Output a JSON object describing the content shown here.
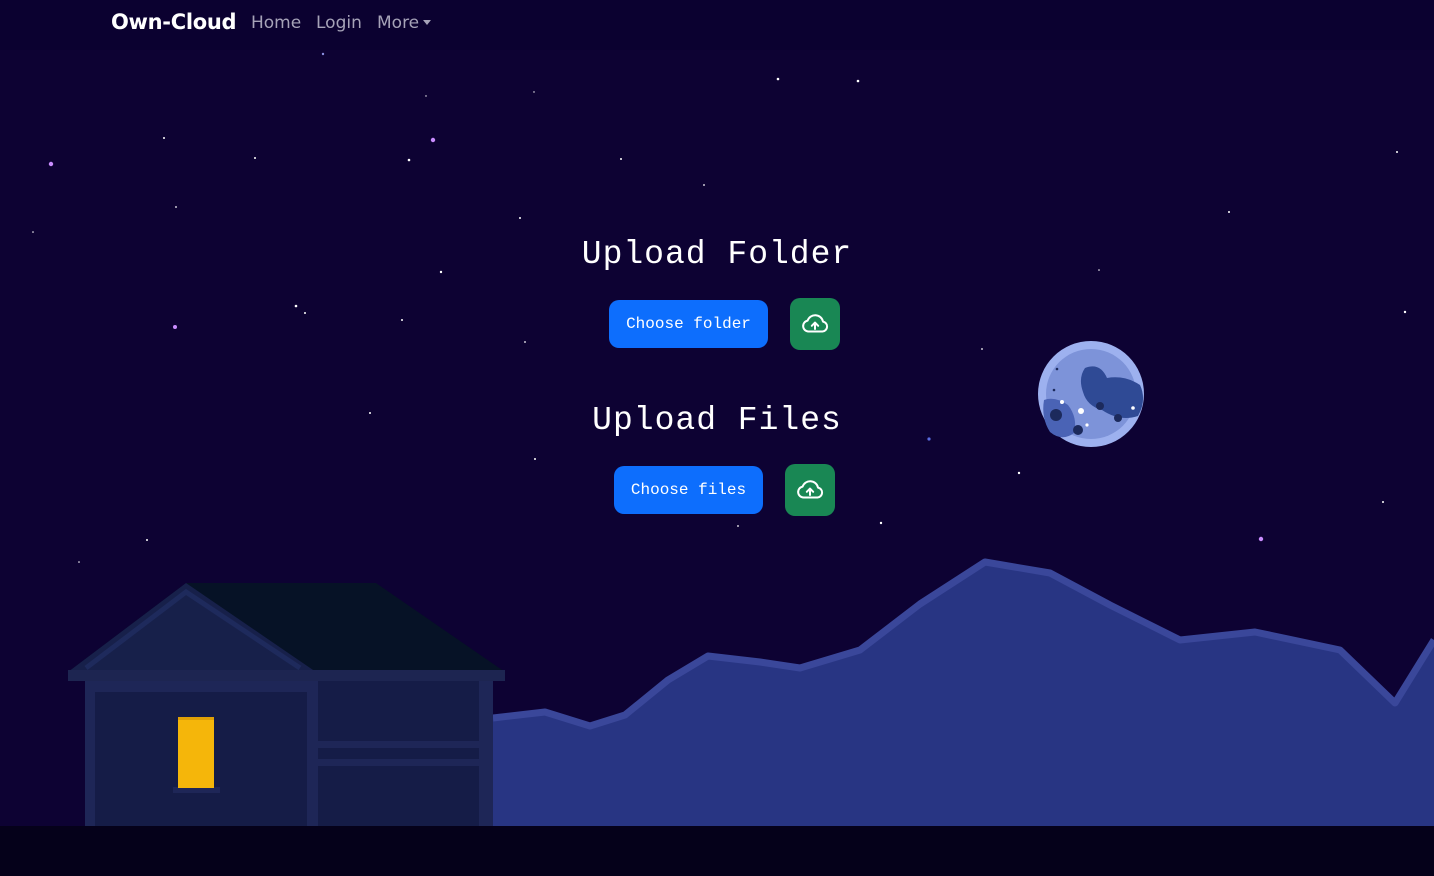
{
  "navbar": {
    "brand": "Own-Cloud",
    "links": {
      "home": "Home",
      "login": "Login",
      "more": "More"
    }
  },
  "upload_folder": {
    "heading": "Upload Folder",
    "choose_label": "Choose folder",
    "upload_icon": "cloud-upload-icon"
  },
  "upload_files": {
    "heading": "Upload Files",
    "choose_label": "Choose files",
    "upload_icon": "cloud-upload-icon"
  },
  "scene": {
    "sky_color": "#0d0233",
    "mountain_color": "#283583",
    "house_color": "#16204d",
    "window_light_color": "#f5b60a",
    "moon": "moon-icon"
  },
  "colors": {
    "primary_button": "#0d6efd",
    "upload_button": "#198754"
  }
}
